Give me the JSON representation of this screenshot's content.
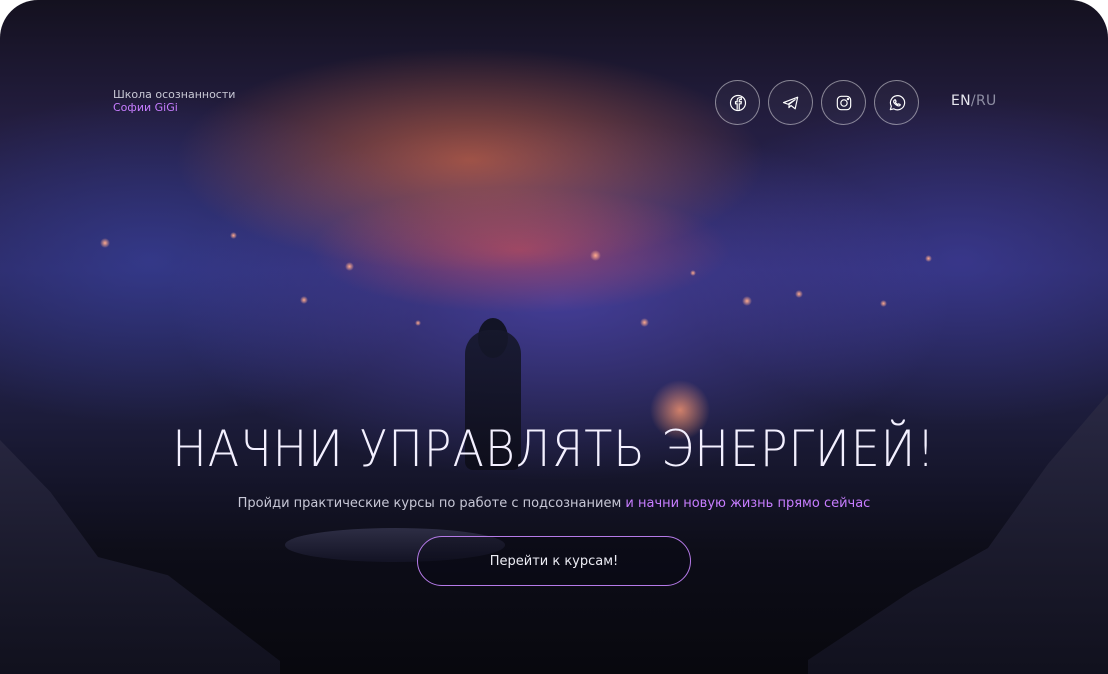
{
  "brand": {
    "line1": "Школа осознанности",
    "line2": "Софии GiGi"
  },
  "socials": [
    {
      "icon": "facebook-icon"
    },
    {
      "icon": "telegram-icon"
    },
    {
      "icon": "instagram-icon"
    },
    {
      "icon": "whatsapp-icon"
    }
  ],
  "lang": {
    "en": "EN",
    "sep": "/",
    "ru": "RU"
  },
  "hero": {
    "headline": "НАЧНИ УПРАВЛЯТЬ ЭНЕРГИЕЙ!",
    "subtitle_main": "Пройди практические курсы по работе с подсознанием ",
    "subtitle_accent": "и начни новую жизнь прямо сейчас",
    "cta": "Перейти к курсам!"
  },
  "colors": {
    "accent": "#c77dff",
    "cta_border": "#b57ae8"
  }
}
